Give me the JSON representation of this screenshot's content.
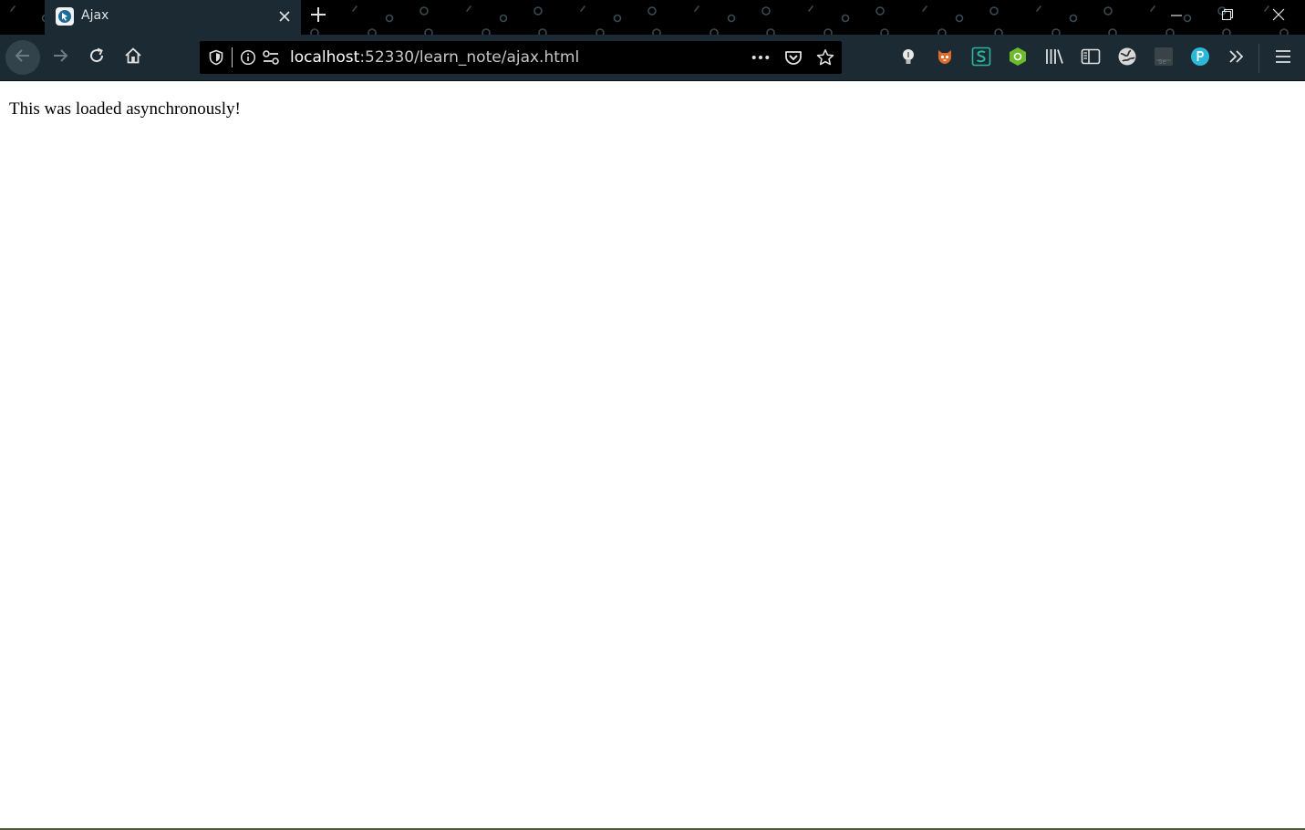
{
  "browser": {
    "tab": {
      "title": "Ajax"
    },
    "url": {
      "host": "localhost",
      "rest": ":52330/learn_note/ajax.html"
    },
    "theme": {
      "tabstrip": "#000000",
      "toolbar": "#1c2b33",
      "urlbar": "#000000"
    }
  },
  "page": {
    "message": "This was loaded asynchronously!"
  },
  "toolbar_icons": [
    "back-arrow-icon",
    "forward-arrow-icon",
    "reload-icon",
    "home-icon",
    "tracking-shield-icon",
    "site-info-icon",
    "permissions-icon",
    "more-actions-icon",
    "pocket-icon",
    "bookmark-star-icon",
    "extension-bulb-icon",
    "extension-fox-icon",
    "extension-s-icon",
    "extension-green-hex-icon",
    "library-icon",
    "sidebar-icon",
    "extension-globe-icon",
    "extension-se-icon",
    "extension-p-icon",
    "overflow-chevrons-icon",
    "hamburger-menu-icon"
  ]
}
